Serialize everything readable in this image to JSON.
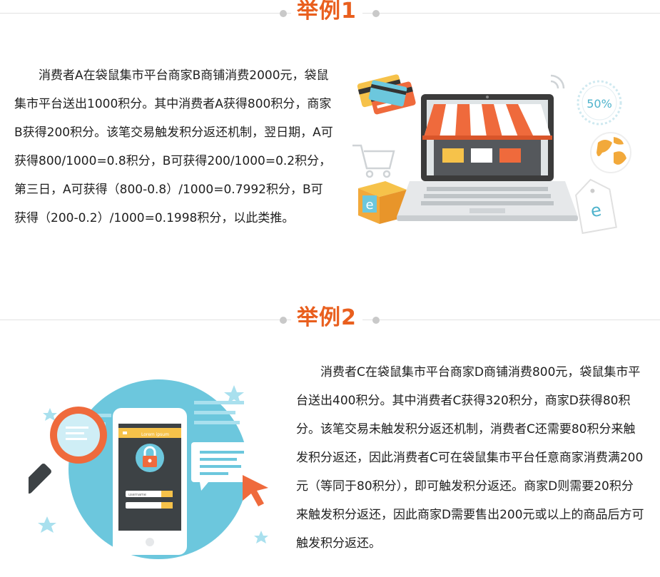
{
  "example1": {
    "title": "举例1",
    "paragraph": "消费者A在袋鼠集市平台商家B商铺消费2000元，袋鼠集市平台送出1000积分。其中消费者A获得800积分，商家B获得200积分。该笔交易触发积分返还机制，翌日期，A可获得800/1000=0.8积分，B可获得200/1000=0.2积分，第三日，A可获得（800-0.8）/1000=0.7992积分，B可获得（200-0.2）/1000=0.1998积分，以此类推。",
    "badge_text": "50%",
    "box_letter": "e",
    "bag_letter": "e"
  },
  "example2": {
    "title": "举例2",
    "paragraph": "消费者C在袋鼠集市平台商家D商铺消费800元，袋鼠集市平台送出400积分。其中消费者C获得320积分，商家D获得80积分。该笔交易未触发积分返还机制，消费者C还需要80积分来触发积分返还，因此消费者C可在袋鼠集市平台任意商家消费满200元（等同于80积分），即可触发积分返还。商家D则需要20积分来触发积分返还，因此商家D需要售出200元或以上的商品后方可触发积分返还。",
    "phone_header": "Lorem ipsum",
    "username_label": "username",
    "colors": {
      "accent": "#e95f1e",
      "circle": "#6cc7dd",
      "lens": "#ef6a3c"
    }
  }
}
